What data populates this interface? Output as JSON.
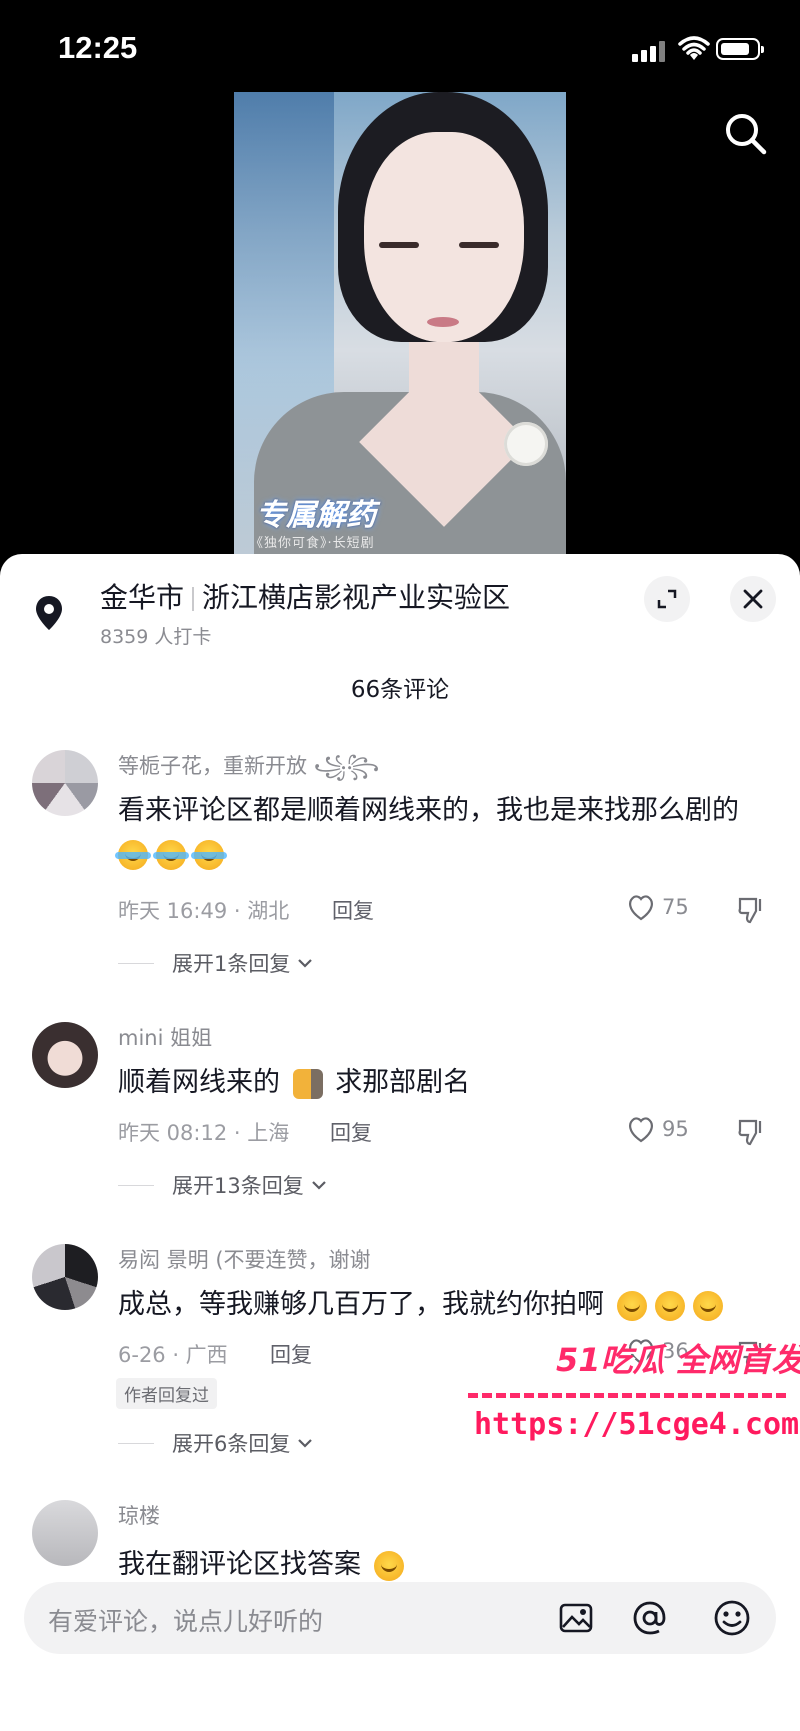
{
  "status": {
    "time": "12:25"
  },
  "video": {
    "caption": "专属解药",
    "caption_sub": "《独你可食》·长短剧"
  },
  "location": {
    "city": "金华市",
    "place": "浙江横店影视产业实验区",
    "checkins": "8359 人打卡"
  },
  "comments_count": "66条评论",
  "comments": [
    {
      "username": "等栀子花，重新开放 ꧁꧂",
      "text": "看来评论区都是顺着网线来的，我也是来找那么剧的",
      "time_loc": "昨天 16:49 · 湖北",
      "reply_label": "回复",
      "likes": "75",
      "expand": "展开1条回复"
    },
    {
      "username": "mini 姐姐",
      "text_a": "顺着网线来的",
      "text_b": "求那部剧名",
      "time_loc": "昨天 08:12 · 上海",
      "reply_label": "回复",
      "likes": "95",
      "expand": "展开13条回复"
    },
    {
      "username": "易闳 景明 (不要连赞，谢谢",
      "text": "成总，等我赚够几百万了，我就约你拍啊",
      "time_loc": "6-26 · 广西",
      "reply_label": "回复",
      "likes": "36",
      "badge": "作者回复过",
      "expand": "展开6条回复"
    },
    {
      "username": "琼楼",
      "text": "我在翻评论区找答案"
    }
  ],
  "input": {
    "placeholder": "有爱评论，说点儿好听的"
  },
  "watermark": {
    "line1": "51吃瓜 全网首发",
    "line2": "https://51cge4.com"
  }
}
